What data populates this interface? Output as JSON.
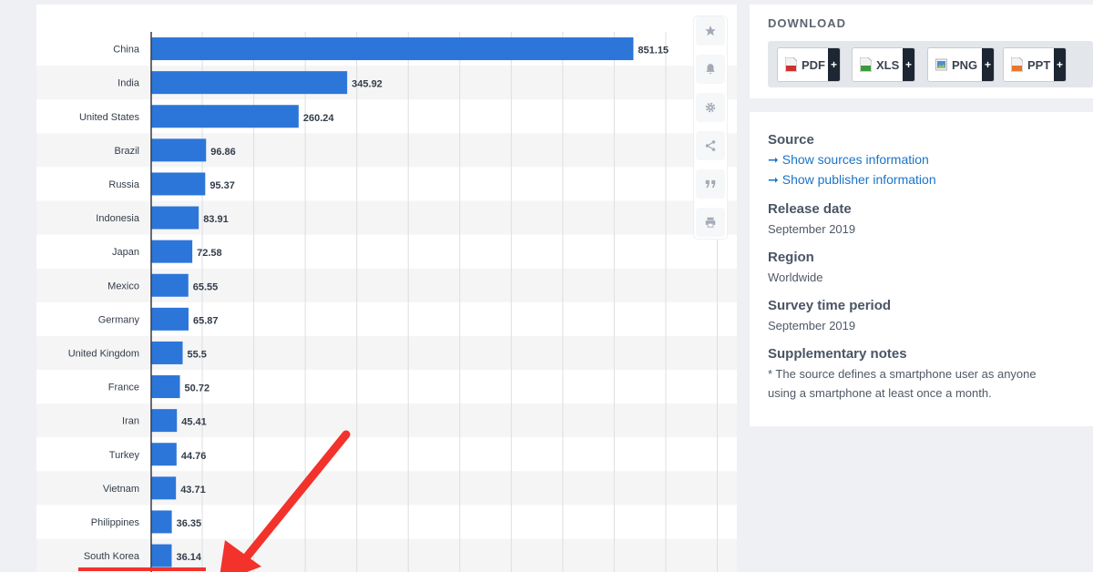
{
  "chart_data": {
    "type": "bar",
    "orientation": "horizontal",
    "categories": [
      "China",
      "India",
      "United States",
      "Brazil",
      "Russia",
      "Indonesia",
      "Japan",
      "Mexico",
      "Germany",
      "United Kingdom",
      "France",
      "Iran",
      "Turkey",
      "Vietnam",
      "Philippines",
      "South Korea"
    ],
    "values": [
      851.15,
      345.92,
      260.24,
      96.86,
      95.37,
      83.91,
      72.58,
      65.55,
      65.87,
      55.5,
      50.72,
      45.41,
      44.76,
      43.71,
      36.35,
      36.14
    ],
    "value_labels": [
      "851.15",
      "345.92",
      "260.24",
      "96.86",
      "95.37",
      "83.91",
      "72.58",
      "65.55",
      "65.87",
      "55.5",
      "50.72",
      "45.41",
      "44.76",
      "43.71",
      "36.35",
      "36.14"
    ],
    "xlim": [
      0,
      1000
    ],
    "grid": true,
    "bar_color": "#2c76d9"
  },
  "annotation": {
    "arrow_color": "#f2322b",
    "underline_color": "#f2322b"
  },
  "tools": [
    "star-icon",
    "bell-icon",
    "gear-icon",
    "share-icon",
    "quote-icon",
    "print-icon"
  ],
  "download": {
    "title": "DOWNLOAD",
    "buttons": [
      {
        "label": "PDF",
        "plus": "+",
        "icon": "pdf-file-icon",
        "color": "#d0312d"
      },
      {
        "label": "XLS",
        "plus": "+",
        "icon": "xls-file-icon",
        "color": "#3b9b3b"
      },
      {
        "label": "PNG",
        "plus": "+",
        "icon": "png-file-icon",
        "color": "#4a8fd8"
      },
      {
        "label": "PPT",
        "plus": "+",
        "icon": "ppt-file-icon",
        "color": "#e8772b"
      }
    ]
  },
  "info": {
    "source_heading": "Source",
    "sources_link": "Show sources information",
    "publisher_link": "Show publisher information",
    "release_heading": "Release date",
    "release_value": "September 2019",
    "region_heading": "Region",
    "region_value": "Worldwide",
    "survey_heading": "Survey time period",
    "survey_value": "September 2019",
    "notes_heading": "Supplementary notes",
    "notes_value": "* The source defines a smartphone user as anyone using a smartphone at least once a month."
  },
  "colors": {
    "link": "#1a73c8",
    "dark": "#1d2733",
    "alt_row": "#f5f5f5"
  }
}
